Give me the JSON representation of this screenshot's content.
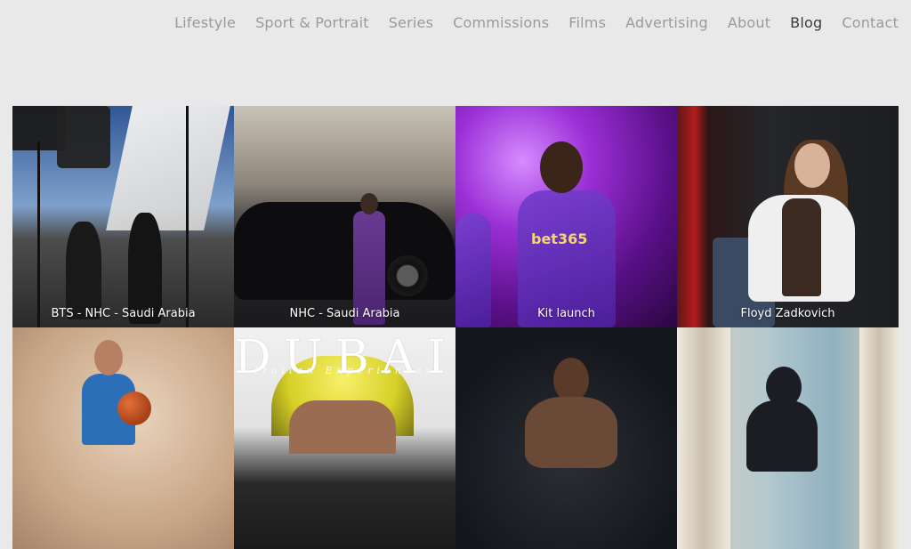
{
  "nav": {
    "items": [
      {
        "label": "Lifestyle",
        "active": false
      },
      {
        "label": "Sport & Portrait",
        "active": false
      },
      {
        "label": "Series",
        "active": false
      },
      {
        "label": "Commissions",
        "active": false
      },
      {
        "label": "Films",
        "active": false
      },
      {
        "label": "Advertising",
        "active": false
      },
      {
        "label": "About",
        "active": false
      },
      {
        "label": "Blog",
        "active": true
      },
      {
        "label": "Contact",
        "active": false
      }
    ]
  },
  "gallery": {
    "tiles": [
      {
        "caption": "BTS - NHC - Saudi Arabia"
      },
      {
        "caption": "NHC - Saudi Arabia"
      },
      {
        "caption": "Kit launch",
        "sponsor": "bet365"
      },
      {
        "caption": "Floyd Zadkovich"
      },
      {
        "caption": ""
      },
      {
        "caption": "",
        "magazine_title": "DUBAI",
        "magazine_subtitle": "Italian Experiences"
      },
      {
        "caption": ""
      },
      {
        "caption": ""
      }
    ]
  },
  "colors": {
    "background": "#e9e9ea",
    "nav_text": "#9a9a9a",
    "nav_active": "#3a3a3a"
  }
}
